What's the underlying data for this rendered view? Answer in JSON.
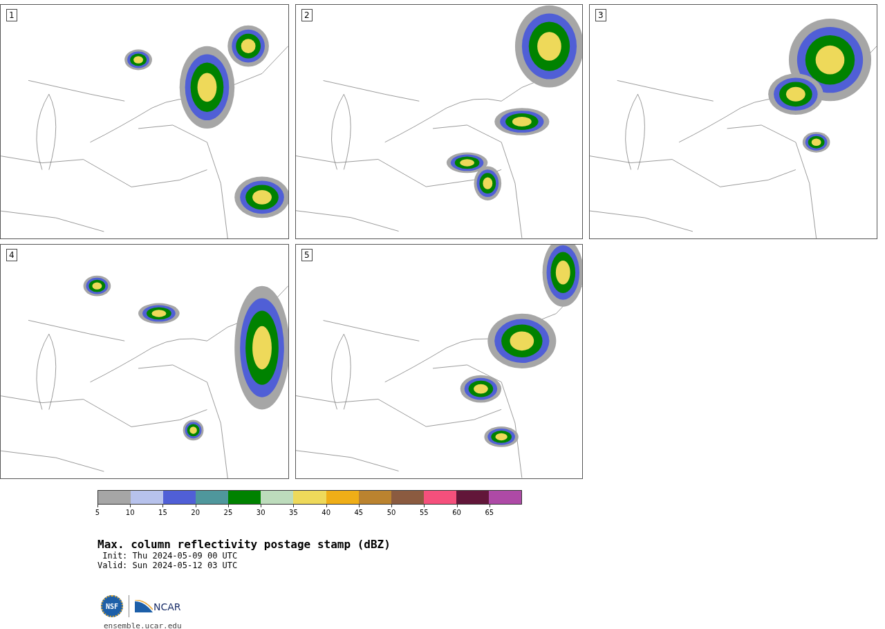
{
  "panels": [
    {
      "label": "1"
    },
    {
      "label": "2"
    },
    {
      "label": "3"
    },
    {
      "label": "4"
    },
    {
      "label": "5"
    }
  ],
  "colorbar": {
    "segments": [
      {
        "color": "#a6a6a6",
        "label": "5"
      },
      {
        "color": "#b7c2ec",
        "label": "10"
      },
      {
        "color": "#505fd6",
        "label": "15"
      },
      {
        "color": "#4f979c",
        "label": "20"
      },
      {
        "color": "#008200",
        "label": "25"
      },
      {
        "color": "#bddcbc",
        "label": "30"
      },
      {
        "color": "#eed95a",
        "label": "35"
      },
      {
        "color": "#efae17",
        "label": "40"
      },
      {
        "color": "#bb832f",
        "label": "45"
      },
      {
        "color": "#8b5b40",
        "label": "50"
      },
      {
        "color": "#f5507c",
        "label": "55"
      },
      {
        "color": "#621639",
        "label": "60"
      },
      {
        "color": "#ae4aa6",
        "label": "65"
      }
    ]
  },
  "title": "Max. column reflectivity postage stamp (dBZ)",
  "init": " Init: Thu 2024-05-09 00 UTC",
  "valid": "Valid: Sun 2024-05-12 03 UTC",
  "logo": {
    "nsf": "NSF",
    "ncar": "NCAR"
  },
  "url": "ensemble.ucar.edu"
}
